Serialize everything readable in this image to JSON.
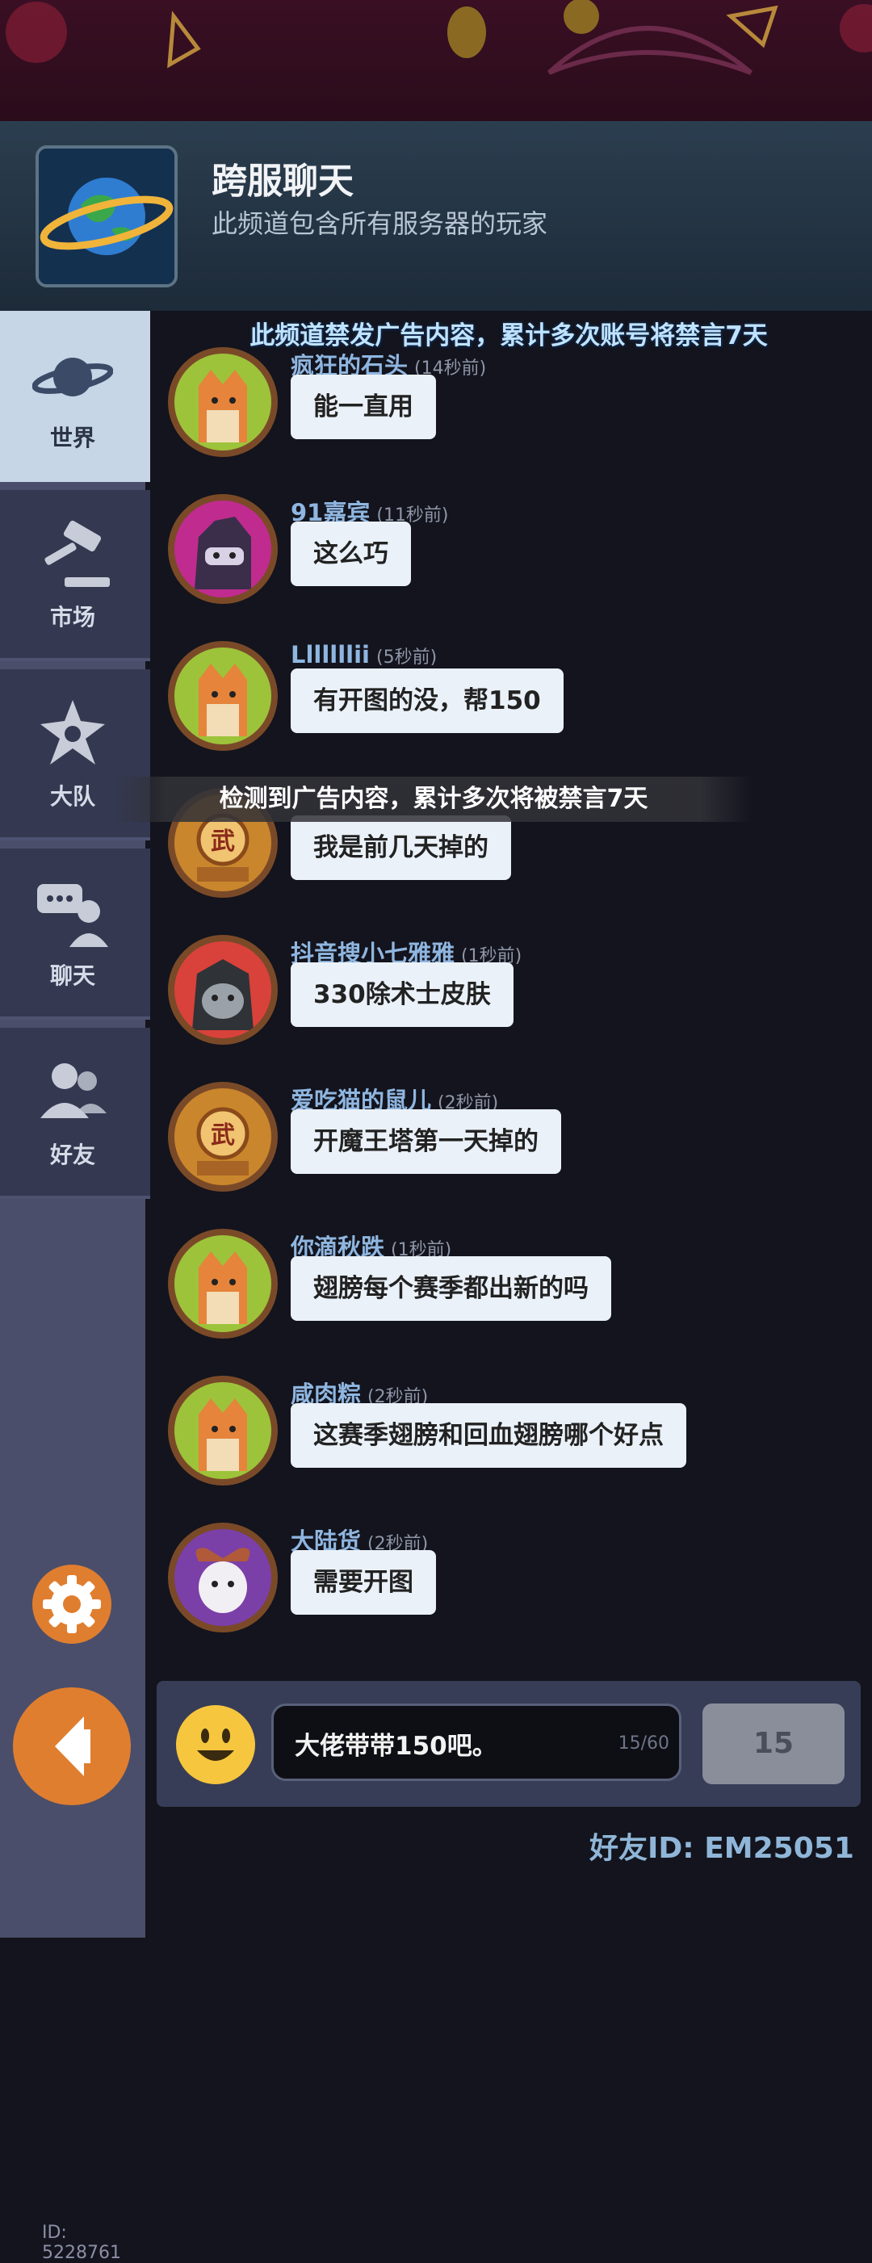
{
  "header": {
    "title": "跨服聊天",
    "subtitle": "此频道包含所有服务器的玩家",
    "icon": "planet-icon"
  },
  "notice": "此频道禁发广告内容，累计多次账号将禁言7天",
  "sidebar": {
    "items": [
      {
        "label": "世界",
        "icon": "saturn-icon",
        "active": true
      },
      {
        "label": "市场",
        "icon": "gavel-icon",
        "active": false
      },
      {
        "label": "大队",
        "icon": "guild-icon",
        "active": false
      },
      {
        "label": "聊天",
        "icon": "chat-bubbles-icon",
        "active": false
      },
      {
        "label": "好友",
        "icon": "friends-icon",
        "active": false
      }
    ],
    "player_id": "ID: 5228761"
  },
  "messages": [
    {
      "name": "疯狂的石头",
      "ago": "(14秒前)",
      "text": "能一直用",
      "avatar": "fox-avatar"
    },
    {
      "name": "91嘉宾",
      "ago": "(11秒前)",
      "text": "这么巧",
      "avatar": "ninja-avatar"
    },
    {
      "name": "Lllllllii",
      "ago": "(5秒前)",
      "text": "有开图的没，帮150",
      "avatar": "fox-avatar"
    },
    {
      "name": "",
      "ago": "",
      "text": "我是前几天掉的",
      "avatar": "wu-emblem-avatar"
    },
    {
      "name": "抖音搜小七雅雅",
      "ago": "(1秒前)",
      "text": "330除术士皮肤",
      "avatar": "cat-hood-avatar"
    },
    {
      "name": "爱吃猫的鼠儿",
      "ago": "(2秒前)",
      "text": "开魔王塔第一天掉的",
      "avatar": "wu-emblem-avatar"
    },
    {
      "name": "你滴秋跌",
      "ago": "(1秒前)",
      "text": "翅膀每个赛季都出新的吗",
      "avatar": "fox-avatar"
    },
    {
      "name": "咸肉粽",
      "ago": "(2秒前)",
      "text": "这赛季翅膀和回血翅膀哪个好点",
      "avatar": "fox-avatar"
    },
    {
      "name": "大陆货",
      "ago": "(2秒前)",
      "text": "需要开图",
      "avatar": "goat-avatar"
    }
  ],
  "toast": "检测到广告内容，累计多次将被禁言7天",
  "input": {
    "value": "大佬带带150吧。",
    "char_count": "15/60",
    "send_label": "15"
  },
  "friend_id": "好友ID: EM25051",
  "colors": {
    "accent_orange": "#e07e2f",
    "bubble": "#eaf1f8",
    "nickname": "#8fb6e0"
  }
}
